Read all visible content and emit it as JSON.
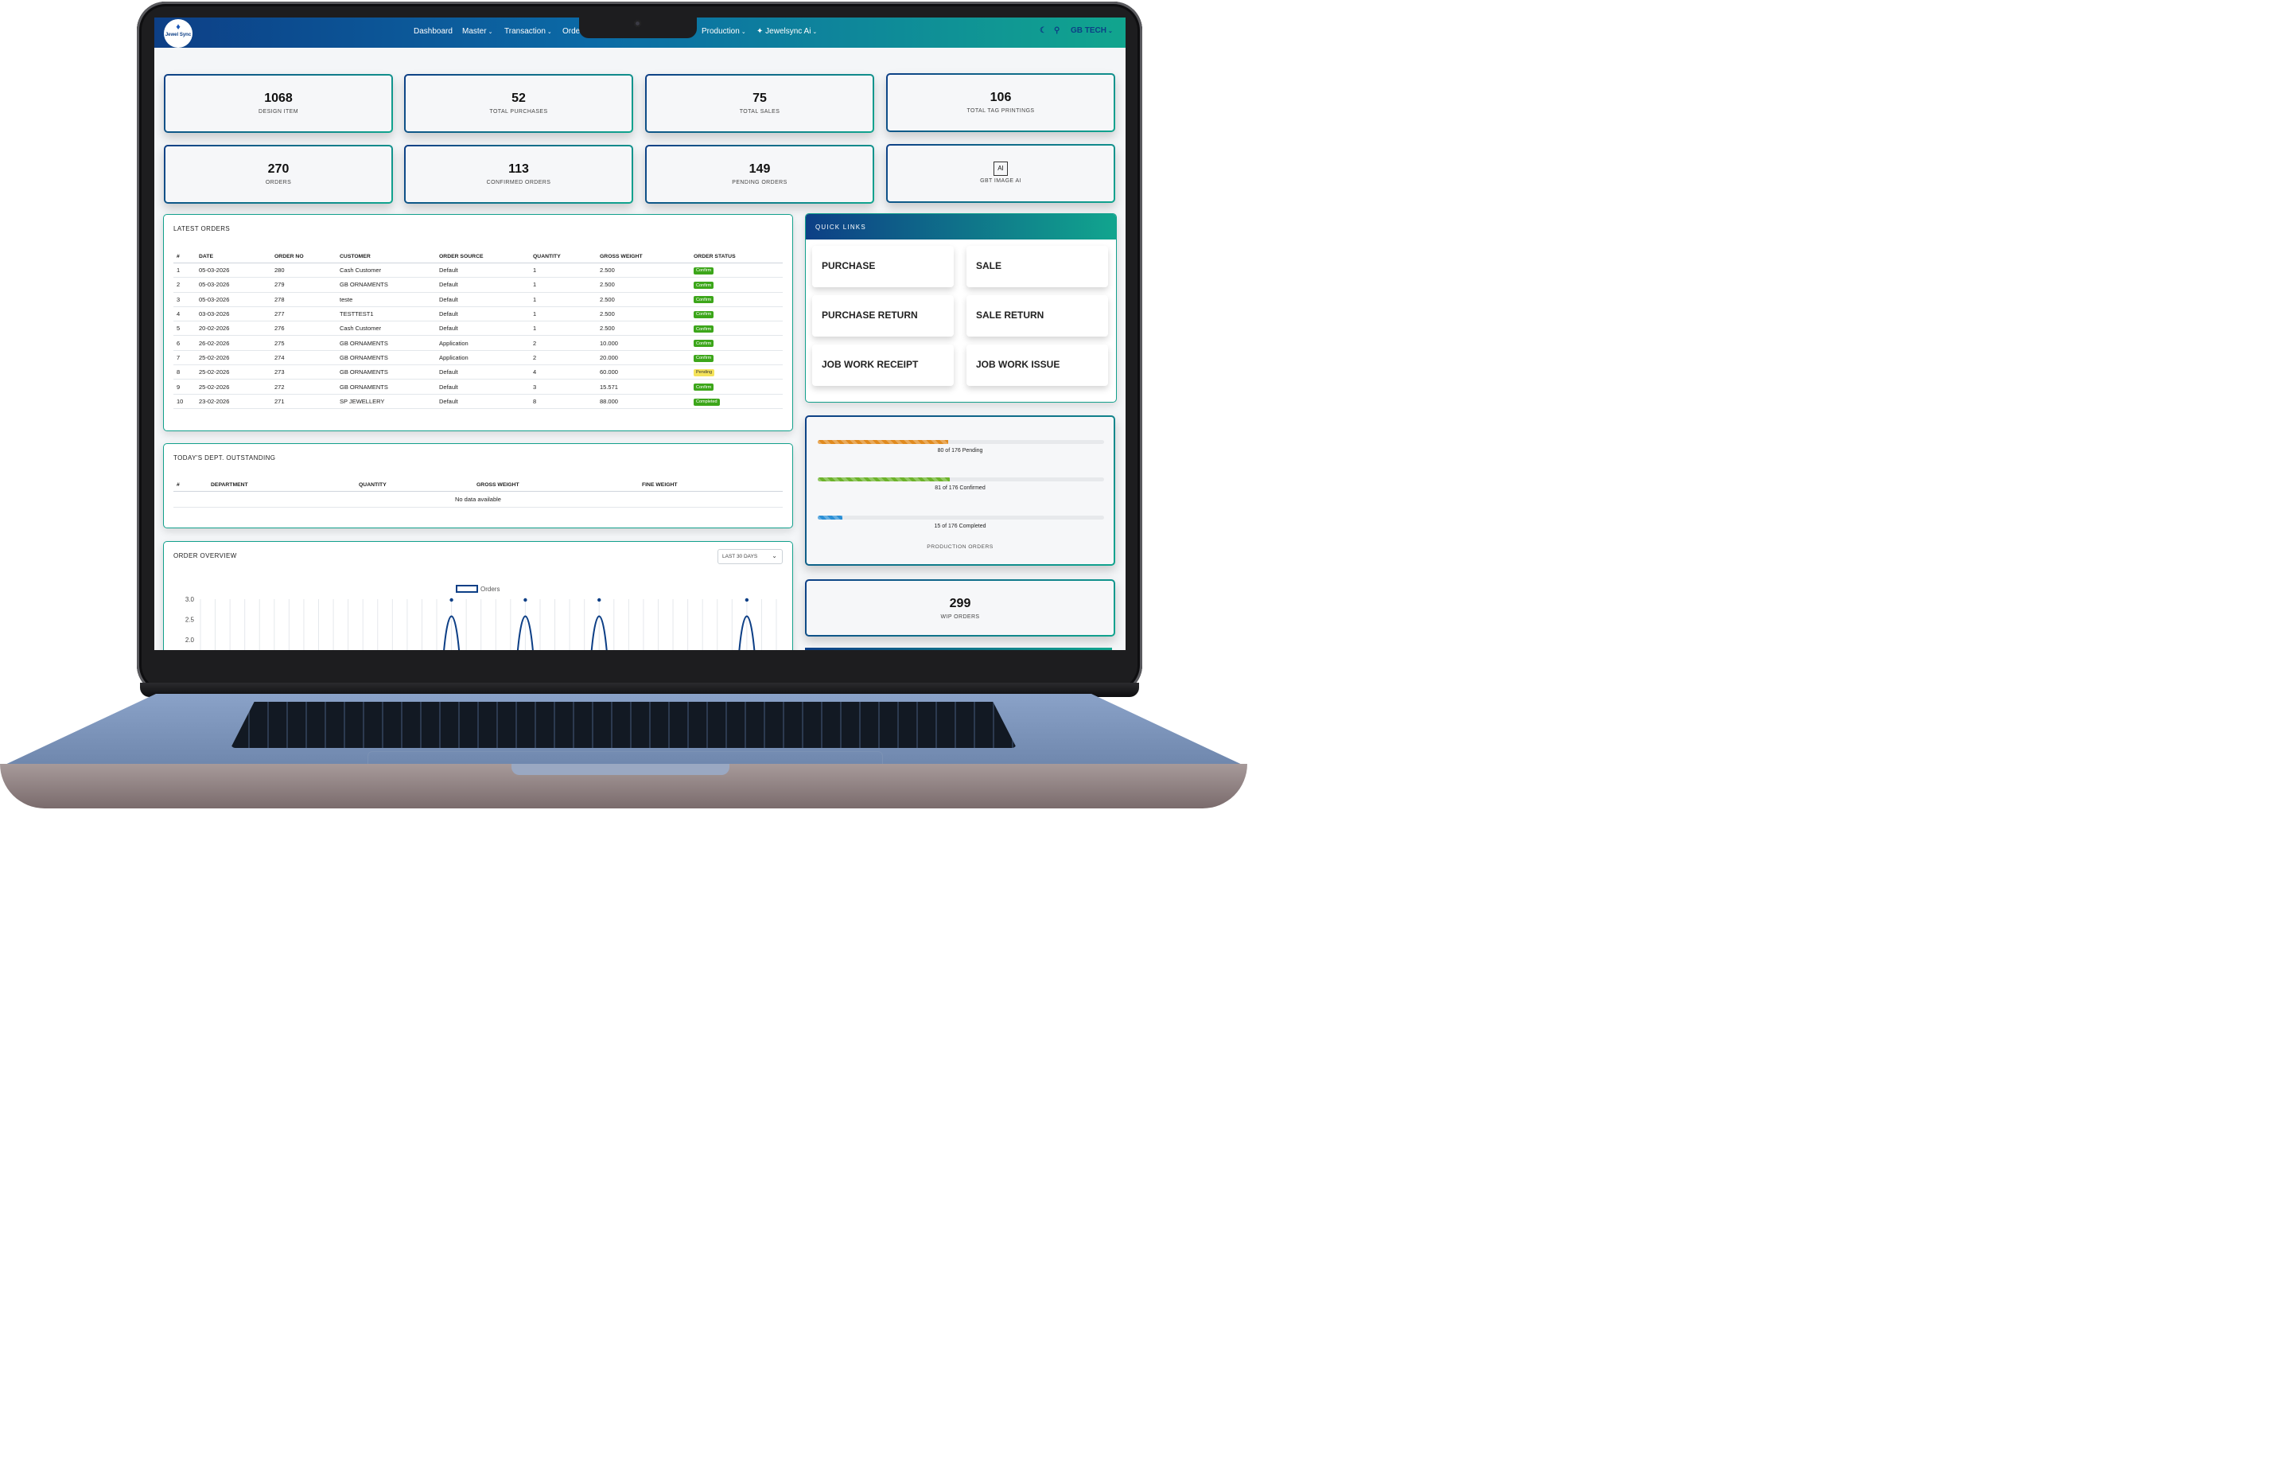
{
  "nav": {
    "logo_text": "Jewel Sync",
    "items": [
      {
        "label": "Dashboard",
        "has_dropdown": false
      },
      {
        "label": "Master",
        "has_dropdown": true
      },
      {
        "label": "Transaction",
        "has_dropdown": true
      },
      {
        "label": "Orde",
        "has_dropdown": false
      },
      {
        "label": "Production",
        "has_dropdown": true
      },
      {
        "label": "Jewelsync Ai",
        "has_dropdown": true
      }
    ],
    "user": "GB TECH",
    "icons": [
      "moon-icon",
      "search-icon",
      "chevron-down-icon"
    ]
  },
  "stats_row1": [
    {
      "value": "1068",
      "label": "DESIGN ITEM"
    },
    {
      "value": "52",
      "label": "TOTAL PURCHASES"
    },
    {
      "value": "75",
      "label": "TOTAL SALES"
    },
    {
      "value": "106",
      "label": "TOTAL TAG PRINTINGS"
    }
  ],
  "stats_row2": [
    {
      "value": "270",
      "label": "ORDERS"
    },
    {
      "value": "113",
      "label": "CONFIRMED ORDERS"
    },
    {
      "value": "149",
      "label": "PENDING ORDERS"
    },
    {
      "value": "",
      "label": "GBT IMAGE AI",
      "icon_text": "AI"
    }
  ],
  "latest_orders": {
    "title": "LATEST ORDERS",
    "columns": [
      "#",
      "DATE",
      "ORDER NO",
      "CUSTOMER",
      "ORDER SOURCE",
      "QUANTITY",
      "GROSS WEIGHT",
      "ORDER STATUS"
    ],
    "rows": [
      [
        "1",
        "05-03-2026",
        "280",
        "Cash Customer",
        "Default",
        "1",
        "2.500",
        "Confirm"
      ],
      [
        "2",
        "05-03-2026",
        "279",
        "GB ORNAMENTS",
        "Default",
        "1",
        "2.500",
        "Confirm"
      ],
      [
        "3",
        "05-03-2026",
        "278",
        "teste",
        "Default",
        "1",
        "2.500",
        "Confirm"
      ],
      [
        "4",
        "03-03-2026",
        "277",
        "TESTTEST1",
        "Default",
        "1",
        "2.500",
        "Confirm"
      ],
      [
        "5",
        "20-02-2026",
        "276",
        "Cash Customer",
        "Default",
        "1",
        "2.500",
        "Confirm"
      ],
      [
        "6",
        "26-02-2026",
        "275",
        "GB ORNAMENTS",
        "Application",
        "2",
        "10.000",
        "Confirm"
      ],
      [
        "7",
        "25-02-2026",
        "274",
        "GB ORNAMENTS",
        "Application",
        "2",
        "20.000",
        "Confirm"
      ],
      [
        "8",
        "25-02-2026",
        "273",
        "GB ORNAMENTS",
        "Default",
        "4",
        "60.000",
        "Pending"
      ],
      [
        "9",
        "25-02-2026",
        "272",
        "GB ORNAMENTS",
        "Default",
        "3",
        "15.571",
        "Confirm"
      ],
      [
        "10",
        "23-02-2026",
        "271",
        "SP JEWELLERY",
        "Default",
        "8",
        "88.000",
        "Completed"
      ]
    ]
  },
  "dept_outstanding": {
    "title": "TODAY'S DEPT. OUTSTANDING",
    "columns": [
      "#",
      "DEPARTMENT",
      "QUANTITY",
      "GROSS WEIGHT",
      "FINE WEIGHT"
    ],
    "empty_text": "No data available"
  },
  "order_overview": {
    "title": "ORDER OVERVIEW",
    "range_select": "LAST 30 DAYS"
  },
  "chart_data": {
    "type": "line",
    "series": [
      {
        "name": "Orders",
        "peaks": [
          {
            "day": 17,
            "value": 3
          },
          {
            "day": 22,
            "value": 3
          },
          {
            "day": 24.5,
            "value": 1.2
          },
          {
            "day": 27,
            "value": 3
          },
          {
            "day": 37,
            "value": 3
          }
        ]
      }
    ],
    "y_ticks": [
      "3.0",
      "2.5",
      "2.0"
    ],
    "ylim": [
      2.0,
      3.0
    ],
    "xlim": [
      0,
      39
    ],
    "grid": true,
    "legend": "top-center",
    "color": "#0d3f86"
  },
  "quick_links": {
    "title": "QUICK LINKS",
    "items": [
      "PURCHASE",
      "SALE",
      "PURCHASE RETURN",
      "SALE RETURN",
      "JOB WORK RECEIPT",
      "JOB WORK ISSUE"
    ]
  },
  "production": {
    "bars": [
      {
        "count": "80",
        "total": "176",
        "status": "Pending",
        "label": "80 of 176 Pending",
        "fraction": 0.4545,
        "color": "#e08a1e"
      },
      {
        "count": "81",
        "total": "176",
        "status": "Confirmed",
        "label": "81 of 176 Confirmed",
        "fraction": 0.4602,
        "color": "#6cb32b"
      },
      {
        "count": "15",
        "total": "176",
        "status": "Completed",
        "label": "15 of 176 Completed",
        "fraction": 0.0852,
        "color": "#2a8fd6"
      }
    ],
    "footer": "PRODUCTION ORDERS"
  },
  "wip": {
    "value": "299",
    "label": "WIP ORDERS"
  }
}
